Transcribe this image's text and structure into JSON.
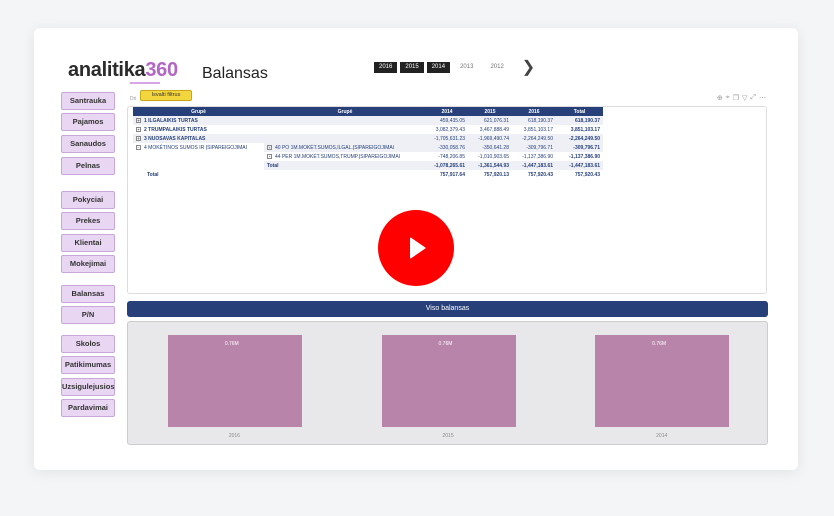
{
  "header": {
    "logo_text": "analitika",
    "logo_num": "360",
    "page_title": "Balansas",
    "years": [
      "2016",
      "2015",
      "2014",
      "2013",
      "2012"
    ],
    "next_icon": "chevron-right-icon"
  },
  "sidebar": {
    "items": [
      "Santrauka",
      "Pajamos",
      "Sanaudos",
      "Pelnas",
      "Pokyciai",
      "Prekes",
      "Klientai",
      "Mokejimai",
      "Balansas",
      "P/N",
      "Skolos",
      "Patikimumas",
      "Uzsigulejusios",
      "Pardavimai"
    ]
  },
  "toolbar": {
    "drill_text": "Dri",
    "tooltip": "Isvalti filtrus"
  },
  "table": {
    "headers": [
      "Grupė",
      "Grupė",
      "2014",
      "2015",
      "2016",
      "Total"
    ],
    "rows": [
      {
        "exp": "+",
        "g1": "1  ILGALAIKIS TURTAS",
        "g2": "",
        "y2014": "459,435.05",
        "y2015": "621,076.31",
        "y2016": "618,190.37",
        "total": "618,190.37"
      },
      {
        "exp": "+",
        "g1": "2  TRUMPALAIKIS TURTAS",
        "g2": "",
        "y2014": "3,082,379.43",
        "y2015": "3,467,888.49",
        "y2016": "3,851,103.17",
        "total": "3,851,103.17"
      },
      {
        "exp": "+",
        "g1": "3  NUOSAVAS KAPITALAS",
        "g2": "",
        "y2014": "-1,705,631.23",
        "y2015": "-1,969,490.74",
        "y2016": "-2,264,249.50",
        "total": "-2,264,249.50"
      },
      {
        "exp": "−",
        "g1": "4  MOKĖTINOS SUMOS IR ĮSIPAREIGOJIMAI",
        "g2": "40  PO 1M.MOKĖT.SUMOS,ILGAL.ĮSIPAREIGOJIMAI",
        "y2014": "-330,058.76",
        "y2015": "-350,641.28",
        "y2016": "-309,796.71",
        "total": "-309,796.71"
      },
      {
        "exp": "",
        "g1": "",
        "g2": "44  PER 1M.MOKĖT.SUMOS,TRUMP.ĮSIPAREIGOJIMAI",
        "y2014": "-748,206.85",
        "y2015": "-1,010,903.65",
        "y2016": "-1,137,386.90",
        "total": "-1,137,386.90"
      },
      {
        "exp": "",
        "g1": "",
        "g2": "Total",
        "y2014": "-1,078,265.61",
        "y2015": "-1,361,544.93",
        "y2016": "-1,447,183.61",
        "total": "-1,447,183.61"
      },
      {
        "exp": "",
        "g1": "Total",
        "g2": "",
        "y2014": "757,917.64",
        "y2015": "757,920.13",
        "y2016": "757,920.43",
        "total": "757,920.43"
      }
    ]
  },
  "viso_title": "Viso balansas",
  "chart_data": {
    "type": "bar",
    "categories": [
      "2016",
      "2015",
      "2014"
    ],
    "values": [
      0.76,
      0.76,
      0.76
    ],
    "data_labels": [
      "0.76M",
      "0.76M",
      "0.76M"
    ],
    "bar_color": "#b884aa"
  },
  "colors": {
    "header_blue": "#27407a",
    "sidebar_bg": "#e8d6f2",
    "play_red": "#ff0000"
  }
}
